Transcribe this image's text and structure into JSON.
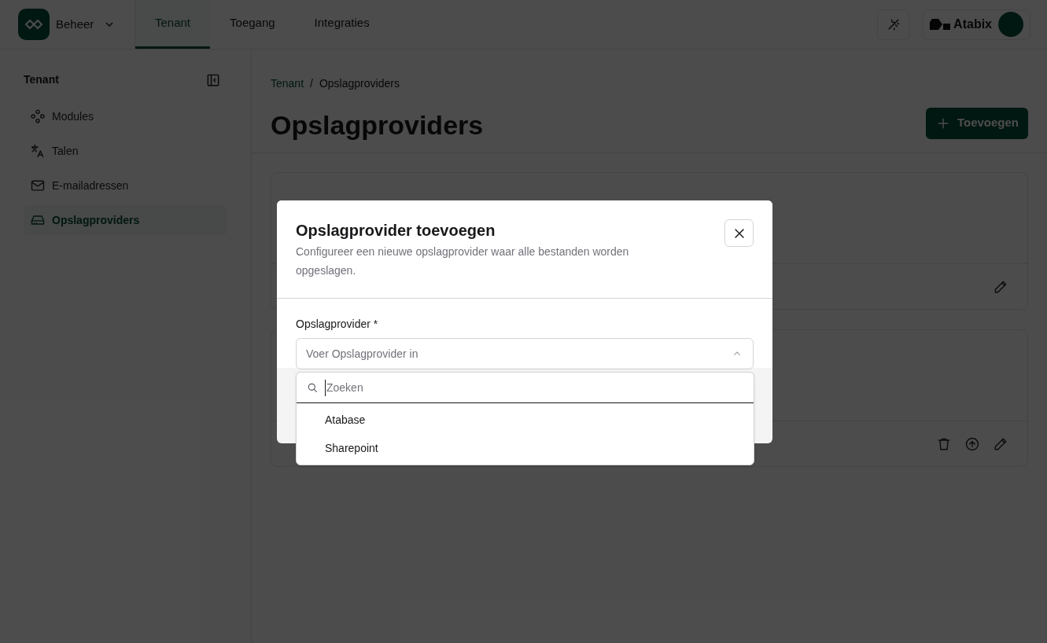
{
  "header": {
    "app": "Beheer",
    "tabs": [
      {
        "label": "Tenant",
        "selected": true
      },
      {
        "label": "Toegang",
        "selected": false
      },
      {
        "label": "Integraties",
        "selected": false
      }
    ],
    "brand": "Atabix"
  },
  "sidebar": {
    "title": "Tenant",
    "items": [
      {
        "label": "Modules",
        "selected": false
      },
      {
        "label": "Talen",
        "selected": false
      },
      {
        "label": "E-mailadressen",
        "selected": false
      },
      {
        "label": "Opslagproviders",
        "selected": true
      }
    ]
  },
  "breadcrumb": [
    "Tenant",
    "Opslagproviders"
  ],
  "breadcrumb_separator": "/",
  "page_title": "Opslagproviders",
  "add_button": "Toevoegen",
  "modal": {
    "title": "Opslagprovider toevoegen",
    "description": "Configureer een nieuwe opslagprovider waar alle bestanden worden opgeslagen.",
    "field_label": "Opslagprovider *",
    "placeholder": "Voer Opslagprovider in",
    "expanded": true,
    "search_placeholder": "Zoeken",
    "options": [
      "Atabase",
      "Sharepoint"
    ]
  }
}
